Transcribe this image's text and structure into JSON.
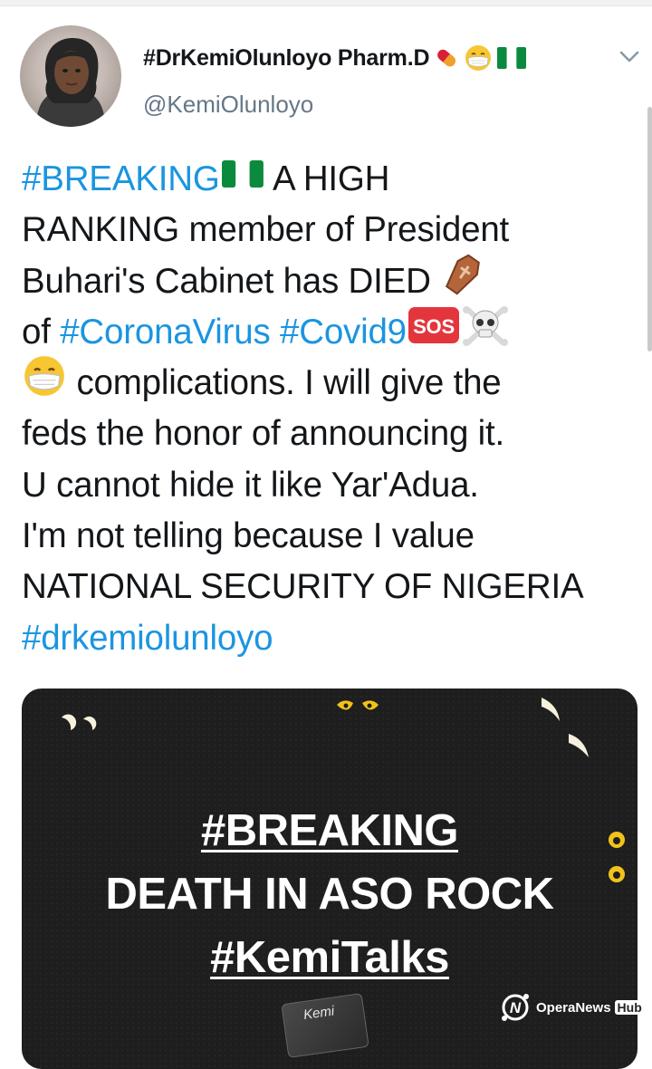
{
  "tweet": {
    "display_name": "#DrKemiOlunloyo Pharm.D",
    "handle": "@KemiOlunloyo",
    "lines": [
      [
        {
          "t": "tag",
          "v": "#BREAKING"
        },
        {
          "t": "icon",
          "v": "nigeria-flag-icon"
        },
        {
          "t": "text",
          "v": " A HIGH"
        }
      ],
      [
        {
          "t": "text",
          "v": "RANKING member of President"
        }
      ],
      [
        {
          "t": "text",
          "v": "Buhari's Cabinet has DIED "
        },
        {
          "t": "icon",
          "v": "coffin-icon"
        }
      ],
      [
        {
          "t": "text",
          "v": "of "
        },
        {
          "t": "tag",
          "v": "#CoronaVirus"
        },
        {
          "t": "text",
          "v": " "
        },
        {
          "t": "tag",
          "v": "#Covid9"
        },
        {
          "t": "icon",
          "v": "sos-icon"
        },
        {
          "t": "icon",
          "v": "skull-crossbones-icon"
        }
      ],
      [
        {
          "t": "icon",
          "v": "mask-face-icon"
        },
        {
          "t": "text",
          "v": " complications. I will give the"
        }
      ],
      [
        {
          "t": "text",
          "v": "feds the honor of announcing it."
        }
      ],
      [
        {
          "t": "text",
          "v": "U cannot hide it like Yar'Adua."
        }
      ],
      [
        {
          "t": "text",
          "v": "I'm not telling because I value"
        }
      ],
      [
        {
          "t": "text",
          "v": "NATIONAL SECURITY OF NIGERIA"
        }
      ],
      [
        {
          "t": "tag",
          "v": "#drkemiolunloyo"
        }
      ]
    ],
    "sos_label": "SOS"
  },
  "media": {
    "line1": "#BREAKING",
    "line2": "DEATH IN ASO ROCK",
    "line3": "#KemiTalks",
    "badge_text": "Kemi"
  },
  "watermark": {
    "brand": "OperaNews",
    "hub": "Hub"
  },
  "colors": {
    "link": "#1b95e0",
    "handle": "#657786",
    "text": "#14171a",
    "media_bg": "#1e1e1e",
    "eyes": "#f2c21b"
  }
}
